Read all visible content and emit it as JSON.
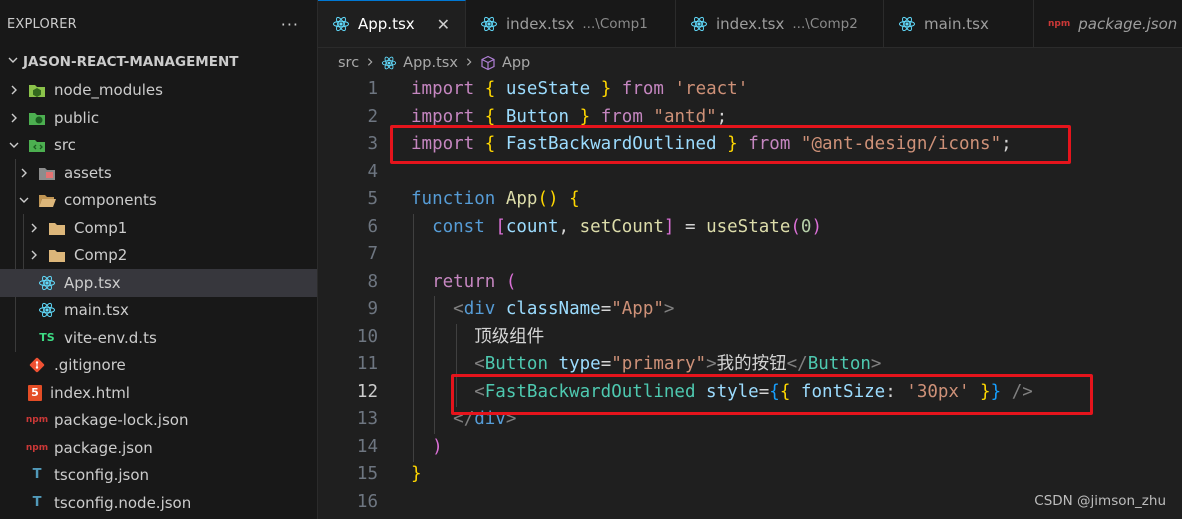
{
  "explorer": {
    "title": "EXPLORER",
    "more_actions": "···",
    "project": "JASON-REACT-MANAGEMENT",
    "items": [
      {
        "label": "node_modules",
        "icon": "node-modules-folder-icon"
      },
      {
        "label": "public",
        "icon": "public-folder-icon"
      },
      {
        "label": "src",
        "icon": "src-folder-icon"
      },
      {
        "label": "assets",
        "icon": "assets-folder-icon"
      },
      {
        "label": "components",
        "icon": "folder-open-icon"
      },
      {
        "label": "Comp1",
        "icon": "folder-icon"
      },
      {
        "label": "Comp2",
        "icon": "folder-icon"
      },
      {
        "label": "App.tsx",
        "icon": "react-icon"
      },
      {
        "label": "main.tsx",
        "icon": "react-icon"
      },
      {
        "label": "vite-env.d.ts",
        "icon": "typescript-icon",
        "badge": "TS"
      },
      {
        "label": ".gitignore",
        "icon": "git-icon"
      },
      {
        "label": "index.html",
        "icon": "html5-icon",
        "badge": "5"
      },
      {
        "label": "package-lock.json",
        "icon": "npm-icon",
        "badge": "npm"
      },
      {
        "label": "package.json",
        "icon": "npm-icon",
        "badge": "npm"
      },
      {
        "label": "tsconfig.json",
        "icon": "tsconfig-icon",
        "badge": "T"
      },
      {
        "label": "tsconfig.node.json",
        "icon": "tsconfig-icon",
        "badge": "T"
      }
    ]
  },
  "tabs": [
    {
      "label": "App.tsx",
      "desc": "",
      "close": "✕"
    },
    {
      "label": "index.tsx",
      "desc": "...\\Comp1"
    },
    {
      "label": "index.tsx",
      "desc": "...\\Comp2"
    },
    {
      "label": "main.tsx",
      "desc": ""
    },
    {
      "label": "package.json",
      "desc": "",
      "badge": "npm"
    }
  ],
  "breadcrumb": {
    "part1": "src",
    "part2": "App.tsx",
    "part3": "App"
  },
  "editor": {
    "line_numbers": [
      "1",
      "2",
      "3",
      "4",
      "5",
      "6",
      "7",
      "8",
      "9",
      "10",
      "11",
      "12",
      "13",
      "14",
      "15",
      "16"
    ],
    "current_line": "12",
    "lines": [
      [
        {
          "t": "import",
          "c": "kw"
        },
        {
          "t": " "
        },
        {
          "t": "{",
          "c": "br1"
        },
        {
          "t": " "
        },
        {
          "t": "useState",
          "c": "var"
        },
        {
          "t": " "
        },
        {
          "t": "}",
          "c": "br1"
        },
        {
          "t": " "
        },
        {
          "t": "from",
          "c": "kw"
        },
        {
          "t": " "
        },
        {
          "t": "'react'",
          "c": "str"
        }
      ],
      [
        {
          "t": "import",
          "c": "kw"
        },
        {
          "t": " "
        },
        {
          "t": "{",
          "c": "br1"
        },
        {
          "t": " "
        },
        {
          "t": "Button",
          "c": "var"
        },
        {
          "t": " "
        },
        {
          "t": "}",
          "c": "br1"
        },
        {
          "t": " "
        },
        {
          "t": "from",
          "c": "kw"
        },
        {
          "t": " "
        },
        {
          "t": "\"antd\"",
          "c": "str"
        },
        {
          "t": ";"
        }
      ],
      [
        {
          "t": "import",
          "c": "kw"
        },
        {
          "t": " "
        },
        {
          "t": "{",
          "c": "br1"
        },
        {
          "t": " "
        },
        {
          "t": "FastBackwardOutlined",
          "c": "var"
        },
        {
          "t": " "
        },
        {
          "t": "}",
          "c": "br1"
        },
        {
          "t": " "
        },
        {
          "t": "from",
          "c": "kw"
        },
        {
          "t": " "
        },
        {
          "t": "\"@ant-design/icons\"",
          "c": "str"
        },
        {
          "t": ";"
        }
      ],
      [],
      [
        {
          "t": "function",
          "c": "dec"
        },
        {
          "t": " "
        },
        {
          "t": "App",
          "c": "fn"
        },
        {
          "t": "()",
          "c": "br1"
        },
        {
          "t": " "
        },
        {
          "t": "{",
          "c": "br1"
        }
      ],
      [
        {
          "t": "  "
        },
        {
          "t": "const",
          "c": "dec"
        },
        {
          "t": " "
        },
        {
          "t": "[",
          "c": "br2"
        },
        {
          "t": "count",
          "c": "var"
        },
        {
          "t": ", "
        },
        {
          "t": "setCount",
          "c": "fn"
        },
        {
          "t": "]",
          "c": "br2"
        },
        {
          "t": " = "
        },
        {
          "t": "useState",
          "c": "fn"
        },
        {
          "t": "(",
          "c": "br2"
        },
        {
          "t": "0",
          "c": "num"
        },
        {
          "t": ")",
          "c": "br2"
        }
      ],
      [],
      [
        {
          "t": "  "
        },
        {
          "t": "return",
          "c": "kw"
        },
        {
          "t": " "
        },
        {
          "t": "(",
          "c": "br2"
        }
      ],
      [
        {
          "t": "    "
        },
        {
          "t": "<",
          "c": "tag"
        },
        {
          "t": "div",
          "c": "dec"
        },
        {
          "t": " "
        },
        {
          "t": "className",
          "c": "var"
        },
        {
          "t": "="
        },
        {
          "t": "\"App\"",
          "c": "str"
        },
        {
          "t": ">",
          "c": "tag"
        }
      ],
      [
        {
          "t": "      "
        },
        {
          "t": "顶级组件",
          "c": "ptx"
        }
      ],
      [
        {
          "t": "      "
        },
        {
          "t": "<",
          "c": "tag"
        },
        {
          "t": "Button",
          "c": "cls"
        },
        {
          "t": " "
        },
        {
          "t": "type",
          "c": "var"
        },
        {
          "t": "="
        },
        {
          "t": "\"primary\"",
          "c": "str"
        },
        {
          "t": ">",
          "c": "tag"
        },
        {
          "t": "我的按钮",
          "c": "ptx"
        },
        {
          "t": "</",
          "c": "tag"
        },
        {
          "t": "Button",
          "c": "cls"
        },
        {
          "t": ">",
          "c": "tag"
        }
      ],
      [
        {
          "t": "      "
        },
        {
          "t": "<",
          "c": "tag"
        },
        {
          "t": "FastBackwardOutlined",
          "c": "cls"
        },
        {
          "t": " "
        },
        {
          "t": "style",
          "c": "var"
        },
        {
          "t": "="
        },
        {
          "t": "{",
          "c": "br3"
        },
        {
          "t": "{",
          "c": "br1"
        },
        {
          "t": " "
        },
        {
          "t": "fontSize",
          "c": "var"
        },
        {
          "t": ": "
        },
        {
          "t": "'30px'",
          "c": "str"
        },
        {
          "t": " "
        },
        {
          "t": "}",
          "c": "br1"
        },
        {
          "t": "}",
          "c": "br3"
        },
        {
          "t": " "
        },
        {
          "t": "/>",
          "c": "tag"
        }
      ],
      [
        {
          "t": "    "
        },
        {
          "t": "</",
          "c": "tag"
        },
        {
          "t": "div",
          "c": "dec"
        },
        {
          "t": ">",
          "c": "tag"
        }
      ],
      [
        {
          "t": "  "
        },
        {
          "t": ")",
          "c": "br2"
        }
      ],
      [
        {
          "t": "}",
          "c": "br1"
        }
      ],
      []
    ]
  },
  "watermark": "CSDN @jimson_zhu",
  "colors": {
    "highlight_box": "#e5141c",
    "active_tab_border": "#0078d4",
    "selected_row": "#37373d"
  }
}
